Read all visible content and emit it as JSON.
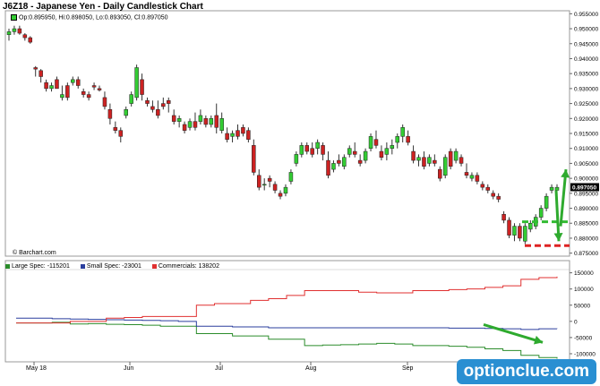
{
  "title": "J6Z18 - Japanese Yen - Daily Candlestick Chart",
  "ohlc": "Op:0.895950, Hi:0.898050, Lo:0.893050, Cl:0.897050",
  "credit": "© Barchart.com",
  "watermark": "optionclue.com",
  "colors": {
    "up": "#33cc33",
    "down": "#cc2222",
    "large": "#2b8c2b",
    "small": "#2b3f9e",
    "commercials": "#e03030",
    "arrow": "#2eaa2e",
    "support": "#dd2222",
    "resistance": "#33bb33"
  },
  "legend": [
    {
      "label": "Large Spec: -115201",
      "color": "#2b8c2b"
    },
    {
      "label": "Small Spec: -23001",
      "color": "#2b3f9e"
    },
    {
      "label": "Commercials: 138202",
      "color": "#e03030"
    }
  ],
  "chart_data": [
    {
      "type": "candlestick",
      "title": "J6Z18 - Japanese Yen - Daily Candlestick Chart",
      "x_ticks": [
        "May 18",
        "Jun",
        "Jul",
        "Aug",
        "Sep"
      ],
      "y_ticks": [
        "0.955000",
        "0.950000",
        "0.945000",
        "0.940000",
        "0.935000",
        "0.930000",
        "0.925000",
        "0.920000",
        "0.915000",
        "0.910000",
        "0.905000",
        "0.900000",
        "0.895000",
        "0.890000",
        "0.885000",
        "0.880000",
        "0.875000"
      ],
      "ylim": [
        0.874,
        0.956
      ],
      "last_price": "0.897050",
      "candles": [
        [
          0.948,
          0.95,
          0.946,
          0.949
        ],
        [
          0.949,
          0.951,
          0.948,
          0.95
        ],
        [
          0.95,
          0.951,
          0.948,
          0.9485
        ],
        [
          0.948,
          0.9485,
          0.946,
          0.947
        ],
        [
          0.947,
          0.9475,
          0.945,
          0.9455
        ],
        [
          0.937,
          0.9375,
          0.934,
          0.9365
        ],
        [
          0.936,
          0.9365,
          0.932,
          0.934
        ],
        [
          0.932,
          0.933,
          0.929,
          0.93
        ],
        [
          0.93,
          0.932,
          0.929,
          0.931
        ],
        [
          0.933,
          0.934,
          0.93,
          0.93
        ],
        [
          0.927,
          0.931,
          0.926,
          0.928
        ],
        [
          0.931,
          0.932,
          0.926,
          0.927
        ],
        [
          0.932,
          0.934,
          0.931,
          0.933
        ],
        [
          0.933,
          0.934,
          0.93,
          0.931
        ],
        [
          0.929,
          0.93,
          0.927,
          0.928
        ],
        [
          0.928,
          0.929,
          0.926,
          0.927
        ],
        [
          0.931,
          0.932,
          0.9295,
          0.9305
        ],
        [
          0.93,
          0.931,
          0.929,
          0.9295
        ],
        [
          0.927,
          0.929,
          0.923,
          0.924
        ],
        [
          0.923,
          0.925,
          0.918,
          0.92
        ],
        [
          0.917,
          0.919,
          0.915,
          0.916
        ],
        [
          0.916,
          0.917,
          0.912,
          0.914
        ],
        [
          0.921,
          0.924,
          0.92,
          0.923
        ],
        [
          0.925,
          0.929,
          0.924,
          0.928
        ],
        [
          0.927,
          0.938,
          0.926,
          0.937
        ],
        [
          0.933,
          0.935,
          0.926,
          0.928
        ],
        [
          0.926,
          0.927,
          0.924,
          0.925
        ],
        [
          0.924,
          0.926,
          0.922,
          0.923
        ],
        [
          0.923,
          0.926,
          0.92,
          0.921
        ],
        [
          0.925,
          0.927,
          0.923,
          0.924
        ],
        [
          0.926,
          0.927,
          0.922,
          0.925
        ],
        [
          0.921,
          0.923,
          0.918,
          0.919
        ],
        [
          0.919,
          0.921,
          0.917,
          0.92
        ],
        [
          0.918,
          0.919,
          0.915,
          0.916
        ],
        [
          0.917,
          0.92,
          0.916,
          0.919
        ],
        [
          0.919,
          0.922,
          0.916,
          0.917
        ],
        [
          0.919,
          0.923,
          0.918,
          0.921
        ],
        [
          0.92,
          0.921,
          0.917,
          0.918
        ],
        [
          0.918,
          0.921,
          0.917,
          0.92
        ],
        [
          0.921,
          0.925,
          0.915,
          0.917
        ],
        [
          0.916,
          0.922,
          0.915,
          0.92
        ],
        [
          0.915,
          0.917,
          0.912,
          0.913
        ],
        [
          0.914,
          0.916,
          0.912,
          0.915
        ],
        [
          0.916,
          0.918,
          0.913,
          0.914
        ],
        [
          0.917,
          0.918,
          0.914,
          0.915
        ],
        [
          0.916,
          0.917,
          0.912,
          0.913
        ],
        [
          0.911,
          0.913,
          0.901,
          0.902
        ],
        [
          0.901,
          0.903,
          0.896,
          0.897
        ],
        [
          0.898,
          0.9,
          0.896,
          0.898
        ],
        [
          0.9,
          0.901,
          0.897,
          0.899
        ],
        [
          0.898,
          0.899,
          0.895,
          0.896
        ],
        [
          0.895,
          0.896,
          0.893,
          0.894
        ],
        [
          0.895,
          0.898,
          0.894,
          0.897
        ],
        [
          0.899,
          0.903,
          0.898,
          0.902
        ],
        [
          0.905,
          0.909,
          0.904,
          0.908
        ],
        [
          0.908,
          0.912,
          0.907,
          0.911
        ],
        [
          0.911,
          0.912,
          0.908,
          0.909
        ],
        [
          0.91,
          0.912,
          0.907,
          0.908
        ],
        [
          0.91,
          0.913,
          0.908,
          0.912
        ],
        [
          0.911,
          0.912,
          0.906,
          0.908
        ],
        [
          0.906,
          0.909,
          0.9,
          0.901
        ],
        [
          0.903,
          0.906,
          0.902,
          0.905
        ],
        [
          0.906,
          0.908,
          0.904,
          0.905
        ],
        [
          0.904,
          0.908,
          0.903,
          0.907
        ],
        [
          0.908,
          0.911,
          0.907,
          0.91
        ],
        [
          0.909,
          0.912,
          0.907,
          0.908
        ],
        [
          0.906,
          0.908,
          0.904,
          0.905
        ],
        [
          0.906,
          0.91,
          0.905,
          0.909
        ],
        [
          0.91,
          0.915,
          0.909,
          0.914
        ],
        [
          0.913,
          0.916,
          0.91,
          0.911
        ],
        [
          0.909,
          0.911,
          0.906,
          0.907
        ],
        [
          0.908,
          0.912,
          0.906,
          0.91
        ],
        [
          0.91,
          0.913,
          0.908,
          0.911
        ],
        [
          0.912,
          0.915,
          0.91,
          0.914
        ],
        [
          0.914,
          0.918,
          0.912,
          0.917
        ],
        [
          0.914,
          0.916,
          0.911,
          0.912
        ],
        [
          0.909,
          0.911,
          0.905,
          0.906
        ],
        [
          0.906,
          0.908,
          0.904,
          0.907
        ],
        [
          0.907,
          0.909,
          0.903,
          0.904
        ],
        [
          0.905,
          0.908,
          0.904,
          0.907
        ],
        [
          0.906,
          0.908,
          0.904,
          0.905
        ],
        [
          0.903,
          0.904,
          0.899,
          0.9
        ],
        [
          0.901,
          0.908,
          0.9,
          0.907
        ],
        [
          0.909,
          0.91,
          0.903,
          0.904
        ],
        [
          0.906,
          0.91,
          0.905,
          0.909
        ],
        [
          0.907,
          0.908,
          0.904,
          0.905
        ],
        [
          0.902,
          0.905,
          0.9,
          0.901
        ],
        [
          0.9,
          0.902,
          0.899,
          0.901
        ],
        [
          0.901,
          0.902,
          0.898,
          0.899
        ],
        [
          0.898,
          0.899,
          0.896,
          0.897
        ],
        [
          0.897,
          0.898,
          0.895,
          0.896
        ],
        [
          0.895,
          0.896,
          0.893,
          0.894
        ],
        [
          0.894,
          0.895,
          0.892,
          0.893
        ],
        [
          0.888,
          0.889,
          0.885,
          0.886
        ],
        [
          0.886,
          0.887,
          0.88,
          0.881
        ],
        [
          0.881,
          0.885,
          0.879,
          0.884
        ],
        [
          0.884,
          0.885,
          0.879,
          0.88
        ],
        [
          0.879,
          0.885,
          0.878,
          0.884
        ],
        [
          0.883,
          0.886,
          0.882,
          0.885
        ],
        [
          0.884,
          0.888,
          0.883,
          0.887
        ],
        [
          0.887,
          0.891,
          0.886,
          0.89
        ],
        [
          0.89,
          0.895,
          0.889,
          0.894
        ],
        [
          0.896,
          0.898,
          0.895,
          0.897
        ],
        [
          0.896,
          0.898,
          0.893,
          0.897
        ]
      ],
      "annotations": {
        "support_level": 0.8775,
        "resistance_level": 0.8855,
        "arrow_down": {
          "from": 0.896,
          "to": 0.879
        },
        "arrow_up": {
          "from": 0.884,
          "to": 0.903
        }
      }
    },
    {
      "type": "line",
      "title": "",
      "x_ticks": [
        "May 18",
        "Jun",
        "Jul",
        "Aug",
        "Sep"
      ],
      "y_ticks": [
        "150000",
        "100000",
        "50000",
        "0",
        "-50000",
        "-100000"
      ],
      "ylim": [
        -125000,
        160000
      ],
      "series": [
        {
          "name": "Large Spec",
          "values": [
            -5000,
            -5000,
            -3000,
            -8000,
            -7000,
            -9000,
            -10000,
            -12000,
            -15000,
            -15000,
            -38000,
            -38000,
            -45000,
            -45000,
            -55000,
            -55000,
            -75000,
            -73000,
            -72000,
            -70000,
            -68000,
            -70000,
            -75000,
            -75000,
            -77000,
            -80000,
            -85000,
            -90000,
            -105000,
            -112000,
            -115201
          ]
        },
        {
          "name": "Small Spec",
          "values": [
            10000,
            10000,
            8000,
            7000,
            6000,
            5000,
            4000,
            3000,
            2000,
            0,
            -15000,
            -15000,
            -17000,
            -17000,
            -20000,
            -20000,
            -20000,
            -20000,
            -20000,
            -20000,
            -20000,
            -20000,
            -20000,
            -20000,
            -21000,
            -21000,
            -22000,
            -23000,
            -25000,
            -23000,
            -23001
          ]
        },
        {
          "name": "Commercials",
          "values": [
            -5000,
            -5000,
            -5000,
            0,
            0,
            10000,
            12000,
            15000,
            15000,
            15000,
            50000,
            55000,
            55000,
            65000,
            70000,
            80000,
            95000,
            95000,
            95000,
            90000,
            88000,
            88000,
            95000,
            95000,
            98000,
            100000,
            105000,
            110000,
            130000,
            135000,
            138202
          ]
        }
      ],
      "annotations": {
        "arrow_down": {
          "from": -10000,
          "to": -65000
        }
      }
    }
  ]
}
